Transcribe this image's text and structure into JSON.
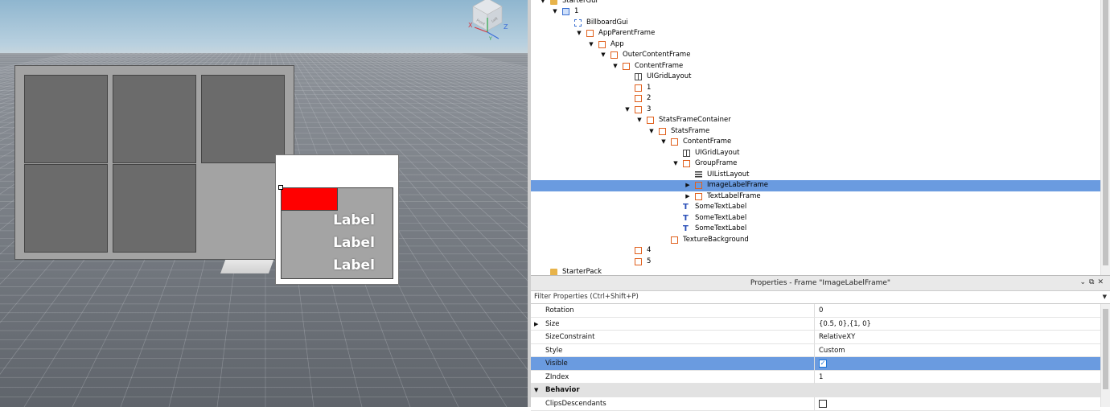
{
  "viewport": {
    "billboard_labels": [
      "Label",
      "Label",
      "Label"
    ],
    "gizmo_axes": [
      "X",
      "Y",
      "Z"
    ],
    "gizmo_faces": [
      "Front",
      "Left"
    ]
  },
  "explorer": {
    "items": [
      {
        "label": "StarterGui",
        "depth": 0,
        "icon": "folder-icon",
        "expanded": true
      },
      {
        "label": "1",
        "depth": 1,
        "icon": "screen-gui-icon",
        "expanded": true
      },
      {
        "label": "BillboardGui",
        "depth": 2,
        "icon": "billboard-gui-icon",
        "expanded": null
      },
      {
        "label": "AppParentFrame",
        "depth": 3,
        "icon": "frame-icon",
        "expanded": true
      },
      {
        "label": "App",
        "depth": 4,
        "icon": "frame-icon",
        "expanded": true
      },
      {
        "label": "OuterContentFrame",
        "depth": 5,
        "icon": "frame-icon",
        "expanded": true
      },
      {
        "label": "ContentFrame",
        "depth": 6,
        "icon": "frame-icon",
        "expanded": true
      },
      {
        "label": "UIGridLayout",
        "depth": 7,
        "icon": "grid-layout-icon",
        "expanded": null
      },
      {
        "label": "1",
        "depth": 7,
        "icon": "frame-icon",
        "expanded": null
      },
      {
        "label": "2",
        "depth": 7,
        "icon": "frame-icon",
        "expanded": null
      },
      {
        "label": "3",
        "depth": 7,
        "icon": "frame-icon",
        "expanded": true
      },
      {
        "label": "StatsFrameContainer",
        "depth": 8,
        "icon": "frame-icon",
        "expanded": true
      },
      {
        "label": "StatsFrame",
        "depth": 9,
        "icon": "frame-icon",
        "expanded": true
      },
      {
        "label": "ContentFrame",
        "depth": 10,
        "icon": "frame-icon",
        "expanded": true
      },
      {
        "label": "UIGridLayout",
        "depth": 11,
        "icon": "grid-layout-icon",
        "expanded": null
      },
      {
        "label": "GroupFrame",
        "depth": 11,
        "icon": "frame-icon",
        "expanded": true
      },
      {
        "label": "UIListLayout",
        "depth": 12,
        "icon": "list-layout-icon",
        "expanded": null
      },
      {
        "label": "ImageLabelFrame",
        "depth": 12,
        "icon": "frame-icon",
        "expanded": false,
        "selected": true
      },
      {
        "label": "TextLabelFrame",
        "depth": 12,
        "icon": "frame-icon",
        "expanded": false
      },
      {
        "label": "SomeTextLabel",
        "depth": 11,
        "icon": "text-label-icon",
        "expanded": null
      },
      {
        "label": "SomeTextLabel",
        "depth": 11,
        "icon": "text-label-icon",
        "expanded": null
      },
      {
        "label": "SomeTextLabel",
        "depth": 11,
        "icon": "text-label-icon",
        "expanded": null
      },
      {
        "label": "TextureBackground",
        "depth": 10,
        "icon": "frame-icon",
        "expanded": null
      },
      {
        "label": "4",
        "depth": 7,
        "icon": "frame-icon",
        "expanded": null
      },
      {
        "label": "5",
        "depth": 7,
        "icon": "frame-icon",
        "expanded": null
      },
      {
        "label": "StarterPack",
        "depth": 0,
        "icon": "folder-icon",
        "expanded": null
      }
    ]
  },
  "properties": {
    "title": "Properties - Frame \"ImageLabelFrame\"",
    "filter_placeholder": "Filter Properties (Ctrl+Shift+P)",
    "rows": [
      {
        "name": "Rotation",
        "value": "0"
      },
      {
        "name": "Size",
        "value": "{0.5, 0},{1, 0}",
        "expandable": true
      },
      {
        "name": "SizeConstraint",
        "value": "RelativeXY"
      },
      {
        "name": "Style",
        "value": "Custom"
      },
      {
        "name": "Visible",
        "checkbox": true,
        "checked": true,
        "selected": true
      },
      {
        "name": "ZIndex",
        "value": "1"
      }
    ],
    "category": "Behavior",
    "category_rows": [
      {
        "name": "ClipsDescendants",
        "checkbox": true,
        "checked": false
      }
    ]
  },
  "colors": {
    "selection": "#6a9be0",
    "frame_icon": "#e0601d",
    "red_frame": "#ff0000"
  }
}
